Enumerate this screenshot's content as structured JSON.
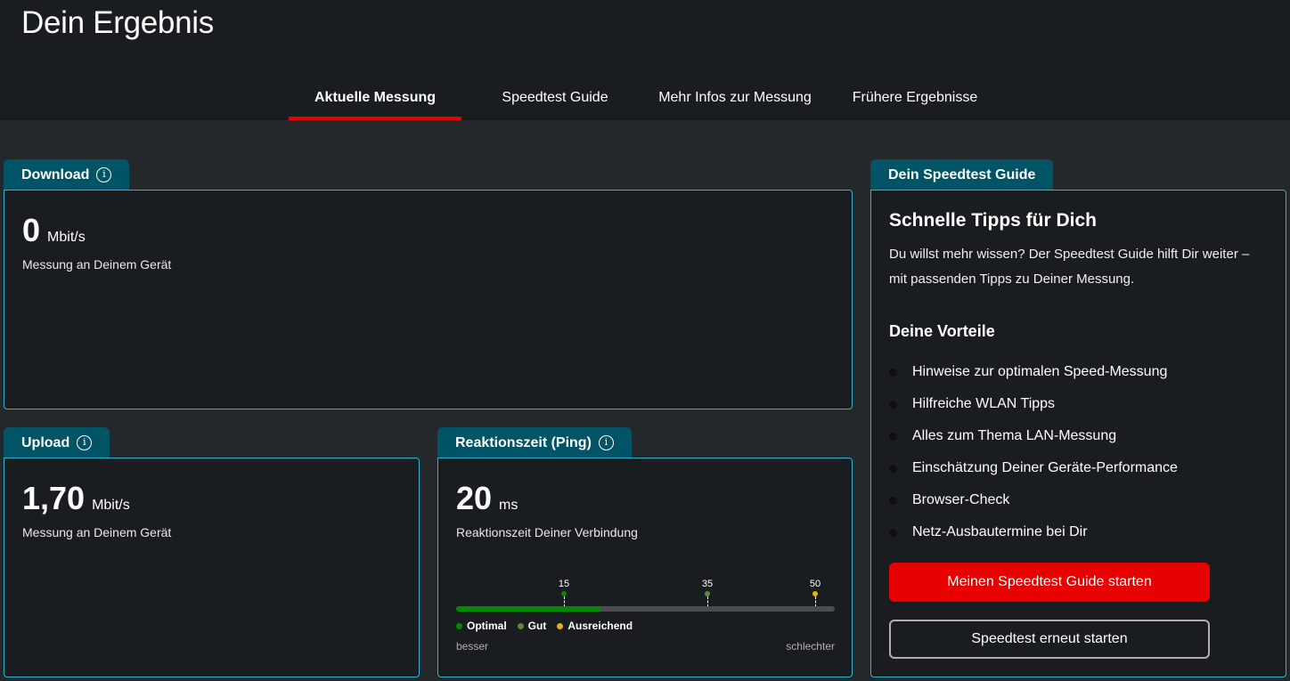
{
  "page": {
    "title": "Dein Ergebnis"
  },
  "tabs": [
    {
      "label": "Aktuelle Messung",
      "active": true
    },
    {
      "label": "Speedtest Guide",
      "active": false
    },
    {
      "label": "Mehr Infos zur Messung",
      "active": false
    },
    {
      "label": "Frühere Ergebnisse",
      "active": false
    }
  ],
  "download": {
    "tab": "Download",
    "value": "0",
    "unit": "Mbit/s",
    "caption": "Messung an Deinem Gerät"
  },
  "upload": {
    "tab": "Upload",
    "value": "1,70",
    "unit": "Mbit/s",
    "caption": "Messung an Deinem Gerät"
  },
  "ping": {
    "tab": "Reaktionszeit (Ping)",
    "value": "20",
    "unit": "ms",
    "caption": "Reaktionszeit Deiner Verbindung",
    "scale": {
      "fill_fraction": 0.38,
      "ticks": [
        {
          "label": "15",
          "color": "#008a00"
        },
        {
          "label": "35",
          "color": "#5a8a3a"
        },
        {
          "label": "50",
          "color": "#e5b800"
        }
      ],
      "legend": [
        {
          "label": "Optimal",
          "color": "#008a00"
        },
        {
          "label": "Gut",
          "color": "#5a8a3a"
        },
        {
          "label": "Ausreichend",
          "color": "#e5b800"
        }
      ],
      "left_label": "besser",
      "right_label": "schlechter"
    }
  },
  "guide": {
    "tab": "Dein Speedtest Guide",
    "title": "Schnelle Tipps für Dich",
    "text": "Du willst mehr wissen? Der Speedtest Guide hilft Dir weiter – mit passenden Tipps zu Deiner Messung.",
    "subtitle": "Deine Vorteile",
    "items": [
      "Hinweise zur optimalen Speed-Messung",
      "Hilfreiche WLAN Tipps",
      "Alles zum Thema LAN-Messung",
      "Einschätzung Deiner Geräte-Performance",
      "Browser-Check",
      "Netz-Ausbautermine bei Dir"
    ],
    "primary_button": "Meinen Speedtest Guide starten",
    "secondary_button": "Speedtest erneut starten"
  },
  "colors": {
    "accent": "#e60000",
    "tab_bg": "#005466",
    "card_border": "#33b3c9"
  }
}
